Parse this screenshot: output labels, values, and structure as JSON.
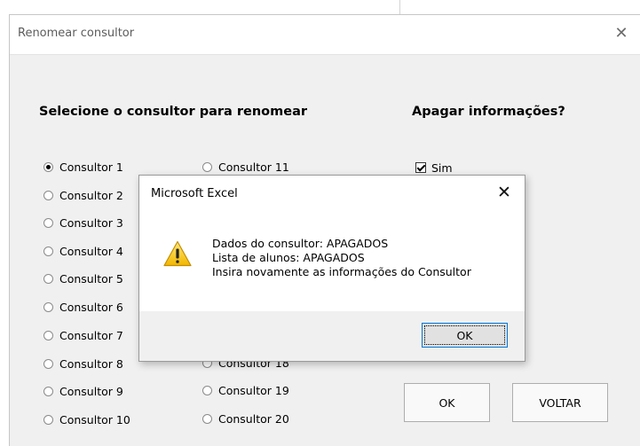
{
  "form": {
    "title": "Renomear consultor",
    "heading_select": "Selecione o consultor para renomear",
    "heading_delete": "Apagar informações?",
    "radios": [
      {
        "label": "Consultor 1",
        "checked": true
      },
      {
        "label": "Consultor 2",
        "checked": false
      },
      {
        "label": "Consultor 3",
        "checked": false
      },
      {
        "label": "Consultor 4",
        "checked": false
      },
      {
        "label": "Consultor 5",
        "checked": false
      },
      {
        "label": "Consultor 6",
        "checked": false
      },
      {
        "label": "Consultor 7",
        "checked": false
      },
      {
        "label": "Consultor 8",
        "checked": false
      },
      {
        "label": "Consultor 9",
        "checked": false
      },
      {
        "label": "Consultor 10",
        "checked": false
      },
      {
        "label": "Consultor 11",
        "checked": false
      },
      {
        "label": "Consultor 18",
        "checked": false
      },
      {
        "label": "Consultor 19",
        "checked": false
      },
      {
        "label": "Consultor 20",
        "checked": false
      }
    ],
    "checkbox_sim": {
      "label": "Sim",
      "checked": true
    },
    "ok_label": "OK",
    "voltar_label": "VOLTAR"
  },
  "msgbox": {
    "title": "Microsoft Excel",
    "lines": [
      "Dados do consultor: APAGADOS",
      "Lista de alunos: APAGADOS",
      "Insira novamente as informações do Consultor"
    ],
    "ok_label": "OK",
    "icon": "warning-icon"
  }
}
